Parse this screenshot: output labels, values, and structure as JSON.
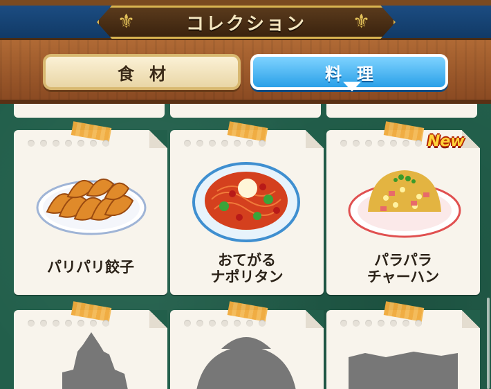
{
  "header": {
    "title": "コレクション"
  },
  "tabs": [
    {
      "label": "食材",
      "active": false
    },
    {
      "label": "料理",
      "active": true
    }
  ],
  "cards": [
    {
      "name_line1": "パリパリ餃子",
      "name_line2": "",
      "is_new": false,
      "dish_icon": "gyoza-icon"
    },
    {
      "name_line1": "おてがる",
      "name_line2": "ナポリタン",
      "is_new": false,
      "dish_icon": "napolitan-spaghetti-icon"
    },
    {
      "name_line1": "パラパラ",
      "name_line2": "チャーハン",
      "is_new": true,
      "dish_icon": "fried-rice-icon"
    },
    {
      "name_line1": "",
      "name_line2": "",
      "is_new": false,
      "dish_icon": "locked-silhouette-icon"
    },
    {
      "name_line1": "",
      "name_line2": "",
      "is_new": false,
      "dish_icon": "locked-silhouette-icon"
    },
    {
      "name_line1": "",
      "name_line2": "",
      "is_new": false,
      "dish_icon": "locked-silhouette-icon"
    }
  ],
  "badge": {
    "new_label": "New"
  },
  "colors": {
    "active_tab": "#2aa0e8",
    "inactive_tab": "#f3e6c0",
    "board": "#225f4b",
    "new_badge": "#ffd23a"
  }
}
